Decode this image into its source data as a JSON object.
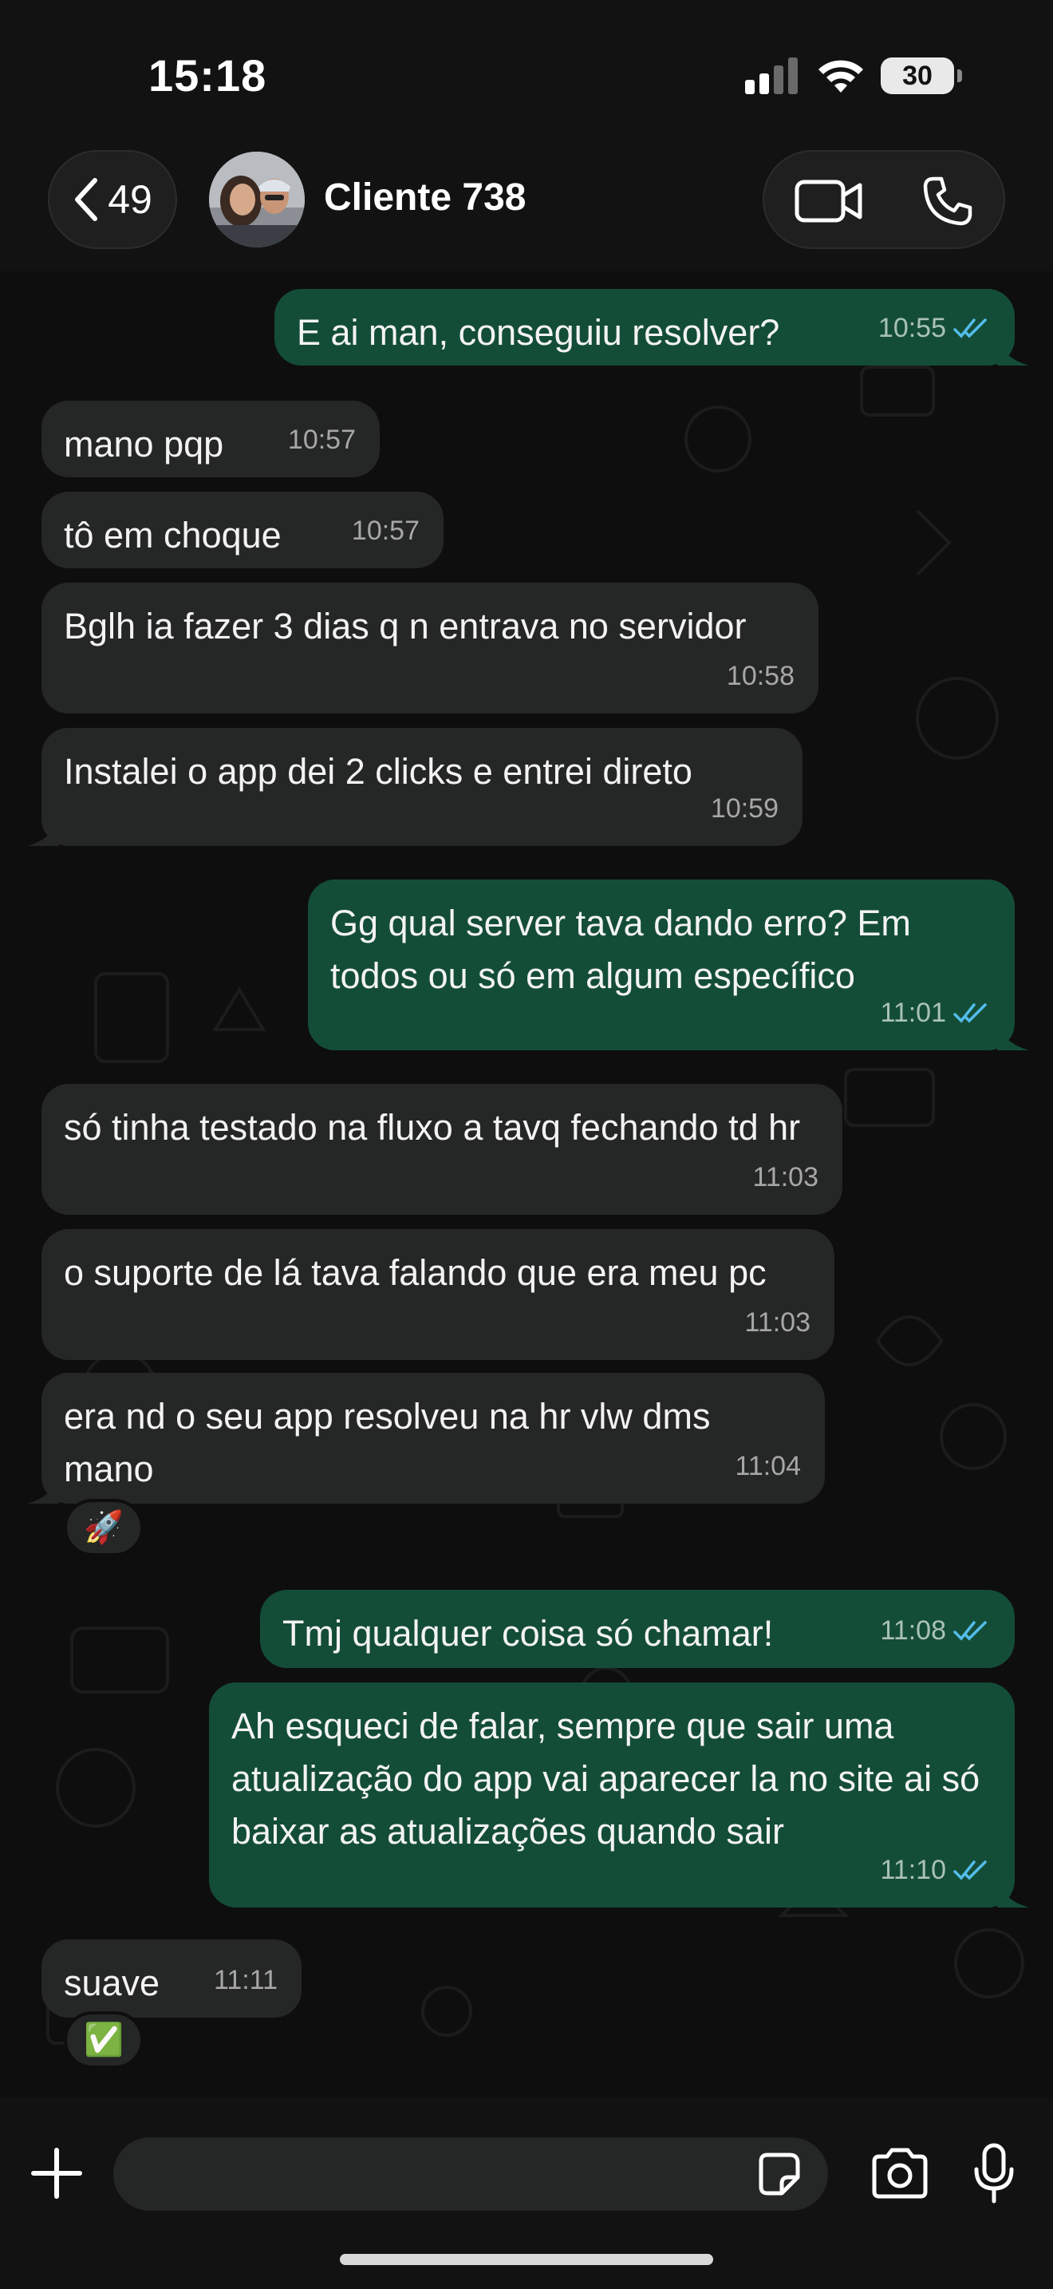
{
  "status_bar": {
    "time": "15:18",
    "battery": "30"
  },
  "header": {
    "back_count": "49",
    "contact_name": "Cliente 738"
  },
  "messages": [
    {
      "dir": "out",
      "text": "E ai man, conseguiu resolver?",
      "time": "10:55"
    },
    {
      "dir": "in",
      "text": "mano pqp",
      "time": "10:57"
    },
    {
      "dir": "in",
      "text": "tô em choque",
      "time": "10:57"
    },
    {
      "dir": "in",
      "text": "Bglh ia fazer 3 dias q n entrava no servidor",
      "time": "10:58"
    },
    {
      "dir": "in",
      "text": "Instalei o app dei 2 clicks e entrei direto",
      "time": "10:59"
    },
    {
      "dir": "out",
      "text": "Gg qual server tava dando erro? Em todos ou só em algum específico",
      "time": "11:01"
    },
    {
      "dir": "in",
      "text": "só tinha testado na fluxo a tavq fechando td hr",
      "time": "11:03"
    },
    {
      "dir": "in",
      "text": "o suporte de lá tava falando que era meu pc",
      "time": "11:03"
    },
    {
      "dir": "in",
      "text": "era nd o seu app resolveu na hr vlw dms mano",
      "time": "11:04",
      "reaction": "🚀"
    },
    {
      "dir": "out",
      "text": "Tmj qualquer coisa só chamar!",
      "time": "11:08"
    },
    {
      "dir": "out",
      "text": "Ah esqueci de falar, sempre que sair uma atualização do app vai aparecer la no site ai só baixar as atualizações quando sair",
      "time": "11:10"
    },
    {
      "dir": "in",
      "text": "suave",
      "time": "11:11",
      "reaction": "✅"
    }
  ],
  "colors": {
    "incoming": "#252626",
    "outgoing": "#144d37",
    "read_ticks": "#53bdeb"
  },
  "icons": [
    "back-chevron-icon",
    "video-call-icon",
    "phone-call-icon",
    "plus-icon",
    "sticker-icon",
    "camera-icon",
    "microphone-icon"
  ]
}
